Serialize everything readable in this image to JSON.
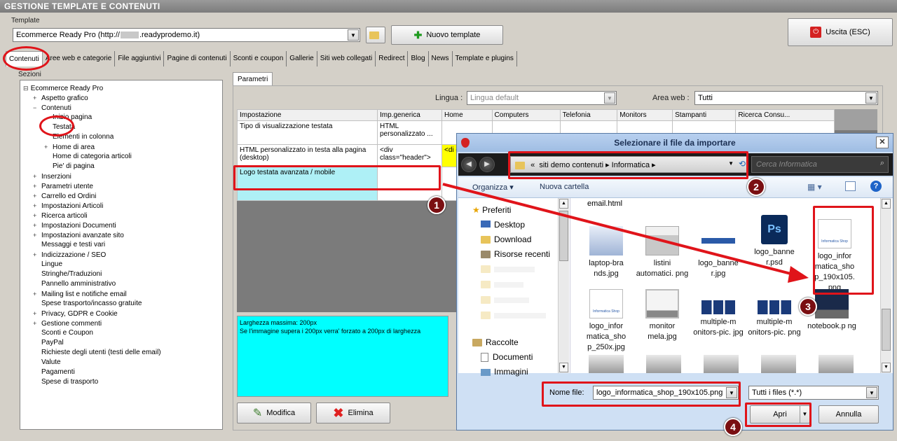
{
  "window": {
    "title": "GESTIONE TEMPLATE E CONTENUTI"
  },
  "template": {
    "label": "Template",
    "selected": "Ecommerce Ready Pro (http://",
    "selected_suffix": ".readyprodemo.it)",
    "new_template": "Nuovo template",
    "exit": "Uscita (ESC)"
  },
  "tabs": [
    "Contenuti",
    "Aree web e categorie",
    "File aggiuntivi",
    "Pagine di contenuti",
    "Sconti e coupon",
    "Gallerie",
    "Siti web collegati",
    "Redirect",
    "Blog",
    "News",
    "Template e plugins"
  ],
  "sections": {
    "label": "Sezioni",
    "root": "Ecommerce Ready Pro",
    "items": [
      {
        "label": "Aspetto grafico",
        "exp": "+",
        "lvl": 1
      },
      {
        "label": "Contenuti",
        "exp": "-",
        "lvl": 1
      },
      {
        "label": "Inizio pagina",
        "exp": "",
        "lvl": 2
      },
      {
        "label": "Testata",
        "exp": "",
        "lvl": 2
      },
      {
        "label": "Elementi in colonna",
        "exp": "",
        "lvl": 2
      },
      {
        "label": "Home di area",
        "exp": "+",
        "lvl": 2
      },
      {
        "label": "Home di categoria articoli",
        "exp": "",
        "lvl": 2
      },
      {
        "label": "Pie' di pagina",
        "exp": "",
        "lvl": 2
      },
      {
        "label": "Inserzioni",
        "exp": "+",
        "lvl": 1
      },
      {
        "label": "Parametri utente",
        "exp": "+",
        "lvl": 1
      },
      {
        "label": "Carrello ed Ordini",
        "exp": "+",
        "lvl": 1
      },
      {
        "label": "Impostazioni Articoli",
        "exp": "+",
        "lvl": 1
      },
      {
        "label": "Ricerca articoli",
        "exp": "+",
        "lvl": 1
      },
      {
        "label": "Impostazioni Documenti",
        "exp": "+",
        "lvl": 1
      },
      {
        "label": "Impostazioni avanzate sito",
        "exp": "+",
        "lvl": 1
      },
      {
        "label": "Messaggi e testi vari",
        "exp": "",
        "lvl": 1
      },
      {
        "label": "Indicizzazione / SEO",
        "exp": "+",
        "lvl": 1
      },
      {
        "label": "Lingue",
        "exp": "",
        "lvl": 1
      },
      {
        "label": "Stringhe/Traduzioni",
        "exp": "",
        "lvl": 1
      },
      {
        "label": "Pannello amministrativo",
        "exp": "",
        "lvl": 1
      },
      {
        "label": "Mailing list e notifiche email",
        "exp": "+",
        "lvl": 1
      },
      {
        "label": "Spese trasporto/incasso gratuite",
        "exp": "",
        "lvl": 1
      },
      {
        "label": "Privacy, GDPR e Cookie",
        "exp": "+",
        "lvl": 1
      },
      {
        "label": "Gestione commenti",
        "exp": "+",
        "lvl": 1
      },
      {
        "label": "Sconti e Coupon",
        "exp": "",
        "lvl": 1
      },
      {
        "label": "PayPal",
        "exp": "",
        "lvl": 1
      },
      {
        "label": "Richieste degli utenti (testi delle email)",
        "exp": "",
        "lvl": 1
      },
      {
        "label": "Valute",
        "exp": "",
        "lvl": 1
      },
      {
        "label": "Pagamenti",
        "exp": "",
        "lvl": 1
      },
      {
        "label": "Spese di trasporto",
        "exp": "",
        "lvl": 1
      }
    ]
  },
  "params": {
    "tab": "Parametri",
    "lingua_label": "Lingua :",
    "lingua_value": "Lingua default",
    "area_label": "Area web :",
    "area_value": "Tutti",
    "columns": [
      "Impostazione",
      "Imp.generica",
      "Home",
      "Computers",
      "Telefonia",
      "Monitors",
      "Stampanti",
      "Ricerca Consu..."
    ],
    "rows": [
      {
        "name": "Tipo di visualizzazione testata",
        "value": "HTML personalizzato ..."
      },
      {
        "name": "HTML personalizzato in testa alla pagina (desktop)",
        "value": "<div class=\"header\">",
        "home": "<di clas"
      },
      {
        "name": "Logo testata avanzata / mobile",
        "value": ""
      }
    ],
    "info_line1": "Larghezza massima: 200px",
    "info_line2": "Se l'immagine supera i 200px verra' forzato a 200px di larghezza",
    "edit": "Modifica",
    "delete": "Elimina"
  },
  "dialog": {
    "title": "Selezionare il file da importare",
    "path_prefix": "«",
    "path": [
      "siti demo contenuti",
      "Informatica"
    ],
    "search_placeholder": "Cerca Informatica",
    "organize": "Organizza",
    "new_folder": "Nuova cartella",
    "nav": {
      "favorites": "Preferiti",
      "fav_items": [
        "Desktop",
        "Download",
        "Risorse recenti"
      ],
      "libraries": "Raccolte",
      "lib_items": [
        "Documenti",
        "Immagini"
      ]
    },
    "top_file": "email.html",
    "files": [
      {
        "name": "laptop-bra nds.jpg",
        "icon": "laptop-thumb-icon"
      },
      {
        "name": "listini automatici. png",
        "icon": "image-thumb-icon"
      },
      {
        "name": "logo_banne r.jpg",
        "icon": "banner-thumb-icon"
      },
      {
        "name": "logo_banne r.psd",
        "icon": "psd-icon"
      },
      {
        "name": "logo_infor matica_sho p_190x105. png",
        "icon": "logo-thumb-icon"
      },
      {
        "name": "logo_infor matica_sho p_250x.jpg",
        "icon": "logo-thumb-icon"
      },
      {
        "name": "monitor mela.jpg",
        "icon": "monitor-thumb-icon"
      },
      {
        "name": "multiple-m onitors-pic. jpg",
        "icon": "monitors-thumb-icon"
      },
      {
        "name": "multiple-m onitors-pic. png",
        "icon": "monitors-thumb-icon"
      },
      {
        "name": "notebook.p ng",
        "icon": "notebook-thumb-icon"
      }
    ],
    "filename_label": "Nome file:",
    "filename_value": "logo_informatica_shop_190x105.png",
    "filter_value": "Tutti i files (*.*)",
    "open": "Apri",
    "cancel": "Annulla",
    "thumb_label": "Informatica Shop"
  },
  "badges": [
    "1",
    "2",
    "3",
    "4"
  ],
  "colors": {
    "accent_red": "#e0141a",
    "highlight_cyan": "#aef0f6",
    "info_cyan": "#00ffff"
  }
}
